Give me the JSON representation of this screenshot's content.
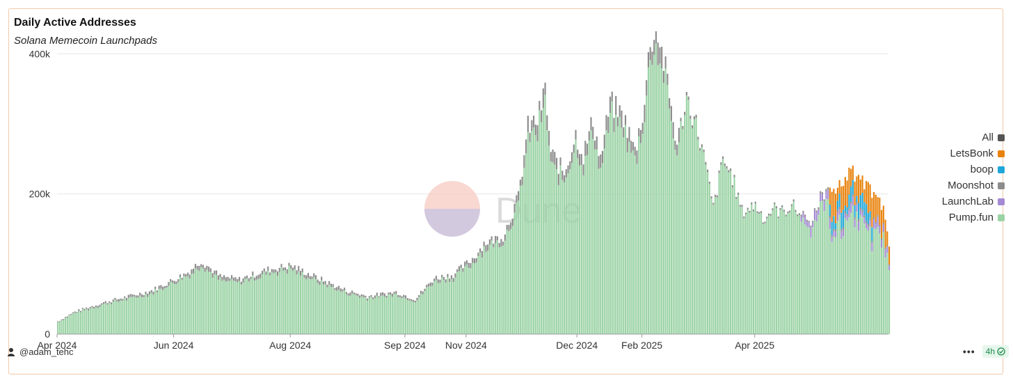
{
  "header": {
    "title": "Daily Active Addresses",
    "subtitle": "Solana Memecoin Launchpads"
  },
  "footer": {
    "author": "@adam_tehc",
    "more_icon": "more-dots-icon",
    "refresh_label": "4h",
    "refresh_icon": "check-circle-icon"
  },
  "watermark": "Dune",
  "colors": {
    "All": "#555555",
    "LetsBonk": "#e8820c",
    "boop": "#1ea7d8",
    "Moonshot": "#8c8c8c",
    "LaunchLab": "#a48ad4",
    "Pump.fun": "#9bd3a5"
  },
  "chart_data": {
    "type": "bar",
    "stacked": true,
    "title": "Daily Active Addresses",
    "subtitle": "Solana Memecoin Launchpads",
    "x_start": "2024-04-01",
    "x_end": "2025-06-10",
    "x_ticks": [
      "Apr 2024",
      "Jun 2024",
      "Aug 2024",
      "Sep 2024",
      "Nov 2024",
      "Dec 2024",
      "Feb 2025",
      "Apr 2025"
    ],
    "x_tick_dates": [
      "2024-04-01",
      "2024-06-01",
      "2024-08-01",
      "2024-09-30",
      "2024-11-01",
      "2024-12-29",
      "2025-02-01",
      "2025-04-01"
    ],
    "y_ticks": [
      "0",
      "200k",
      "400k"
    ],
    "y_tick_values": [
      0,
      200000,
      400000
    ],
    "ylim": [
      0,
      440000
    ],
    "grid": true,
    "legend_position": "right",
    "legend": [
      "All",
      "LetsBonk",
      "boop",
      "Moonshot",
      "LaunchLab",
      "Pump.fun"
    ],
    "series_anchors": {
      "total": [
        [
          "2024-04-01",
          18000
        ],
        [
          "2024-04-10",
          32000
        ],
        [
          "2024-04-25",
          45000
        ],
        [
          "2024-05-10",
          55000
        ],
        [
          "2024-05-20",
          62000
        ],
        [
          "2024-06-01",
          78000
        ],
        [
          "2024-06-08",
          88000
        ],
        [
          "2024-06-15",
          105000
        ],
        [
          "2024-06-25",
          82000
        ],
        [
          "2024-07-05",
          78000
        ],
        [
          "2024-07-20",
          92000
        ],
        [
          "2024-08-01",
          98000
        ],
        [
          "2024-08-15",
          80000
        ],
        [
          "2024-08-30",
          62000
        ],
        [
          "2024-09-10",
          54000
        ],
        [
          "2024-09-25",
          60000
        ],
        [
          "2024-10-05",
          50000
        ],
        [
          "2024-10-15",
          80000
        ],
        [
          "2024-10-25",
          85000
        ],
        [
          "2024-11-05",
          110000
        ],
        [
          "2024-11-10",
          130000
        ],
        [
          "2024-11-20",
          140000
        ],
        [
          "2024-11-28",
          195000
        ],
        [
          "2024-12-03",
          295000
        ],
        [
          "2024-12-08",
          305000
        ],
        [
          "2024-12-12",
          348000
        ],
        [
          "2024-12-15",
          258000
        ],
        [
          "2024-12-22",
          230000
        ],
        [
          "2024-12-28",
          285000
        ],
        [
          "2025-01-01",
          255000
        ],
        [
          "2025-01-06",
          305000
        ],
        [
          "2025-01-10",
          250000
        ],
        [
          "2025-01-15",
          330000
        ],
        [
          "2025-01-22",
          310000
        ],
        [
          "2025-01-28",
          260000
        ],
        [
          "2025-02-02",
          330000
        ],
        [
          "2025-02-05",
          420000
        ],
        [
          "2025-02-09",
          430000
        ],
        [
          "2025-02-13",
          375000
        ],
        [
          "2025-02-19",
          270000
        ],
        [
          "2025-02-24",
          340000
        ],
        [
          "2025-03-01",
          300000
        ],
        [
          "2025-03-05",
          255000
        ],
        [
          "2025-03-10",
          180000
        ],
        [
          "2025-03-15",
          250000
        ],
        [
          "2025-03-20",
          225000
        ],
        [
          "2025-03-25",
          175000
        ],
        [
          "2025-04-01",
          185000
        ],
        [
          "2025-04-06",
          165000
        ],
        [
          "2025-04-10",
          180000
        ],
        [
          "2025-04-15",
          175000
        ],
        [
          "2025-04-20",
          185000
        ],
        [
          "2025-04-25",
          170000
        ],
        [
          "2025-04-30",
          155000
        ],
        [
          "2025-05-05",
          195000
        ],
        [
          "2025-05-15",
          210000
        ],
        [
          "2025-05-20",
          230000
        ],
        [
          "2025-05-25",
          225000
        ],
        [
          "2025-06-01",
          200000
        ],
        [
          "2025-06-05",
          185000
        ],
        [
          "2025-06-08",
          170000
        ],
        [
          "2025-06-10",
          120000
        ]
      ],
      "LetsBonk_start": "2025-05-10",
      "boop_window": [
        "2025-05-10",
        "2025-06-01"
      ],
      "LaunchLab_start": "2025-04-25",
      "LetsBonk_peak": 45000,
      "boop_peak": 25000,
      "LaunchLab_peak": 15000
    }
  }
}
